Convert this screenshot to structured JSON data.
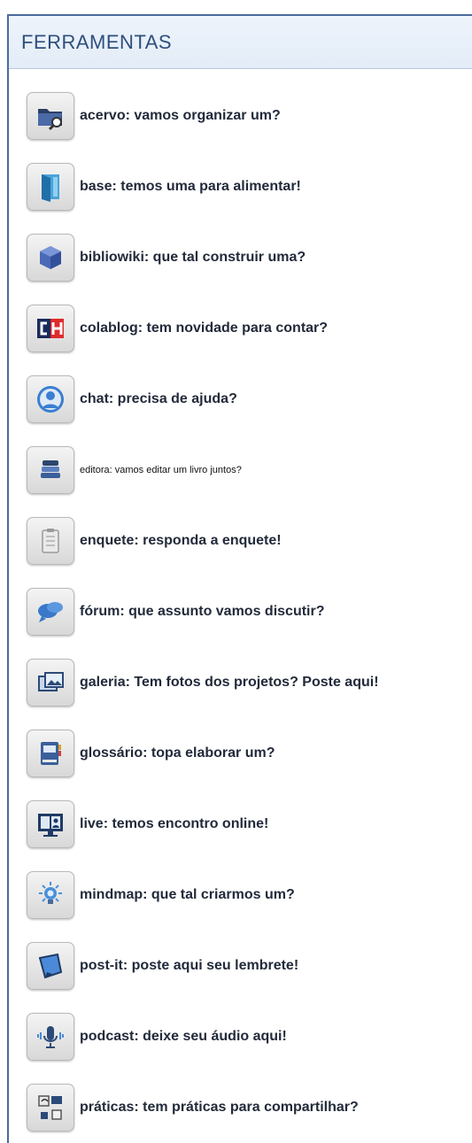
{
  "panel": {
    "title": "FERRAMENTAS"
  },
  "tools": [
    {
      "icon": "folder-search-icon",
      "label": "acervo: vamos organizar um?"
    },
    {
      "icon": "open-door-icon",
      "label": "base: temos uma para alimentar!"
    },
    {
      "icon": "cube-icon",
      "label": "bibliowiki: que tal construir uma?"
    },
    {
      "icon": "ch-logo-icon",
      "label": "colablog: tem novidade para contar?"
    },
    {
      "icon": "user-chat-icon",
      "label": "chat: precisa de ajuda?"
    },
    {
      "icon": "books-stack-icon",
      "label": "editora: vamos editar um livro juntos?"
    },
    {
      "icon": "clipboard-icon",
      "label": "enquete: responda a enquete!"
    },
    {
      "icon": "speech-bubbles-icon",
      "label": "fórum: que assunto vamos discutir?"
    },
    {
      "icon": "photo-gallery-icon",
      "label": "galeria: Tem fotos dos projetos? Poste aqui!"
    },
    {
      "icon": "glossary-book-icon",
      "label": "glossário: topa elaborar um?"
    },
    {
      "icon": "live-screen-icon",
      "label": "live: temos encontro online!"
    },
    {
      "icon": "lightbulb-icon",
      "label": "mindmap: que tal criarmos um?"
    },
    {
      "icon": "sticky-note-icon",
      "label": "post-it: poste aqui seu lembrete!"
    },
    {
      "icon": "microphone-icon",
      "label": "podcast: deixe seu áudio aqui!"
    },
    {
      "icon": "media-tiles-icon",
      "label": "práticas: tem práticas para compartilhar?"
    }
  ]
}
